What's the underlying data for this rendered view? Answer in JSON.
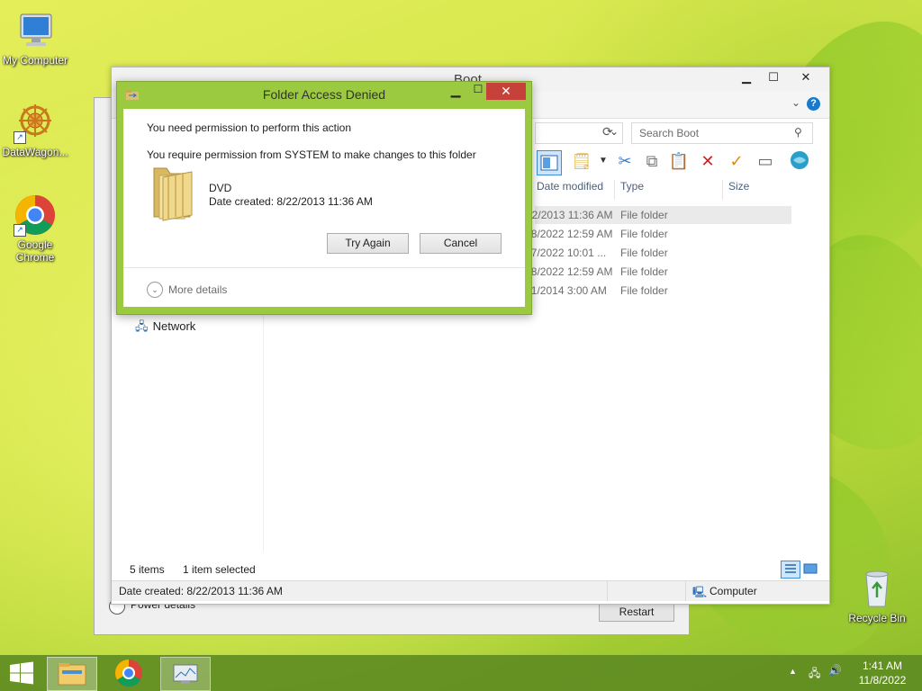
{
  "desktop": {
    "icons": [
      {
        "label": "My Computer",
        "icon": "computer-icon"
      },
      {
        "label": "DataWagon...",
        "icon": "datawagon-icon"
      },
      {
        "label": "Google Chrome",
        "icon": "chrome-icon"
      },
      {
        "label": "Recycle Bin",
        "icon": "recycle-bin-icon"
      }
    ]
  },
  "background_dialog": {
    "radio_label": "Power details",
    "button_label": "Restart"
  },
  "explorer": {
    "title": "Boot",
    "search_placeholder": "Search Boot",
    "columns": [
      "Date modified",
      "Type",
      "Size"
    ],
    "rows": [
      {
        "date": "8/22/2013 11:36 AM",
        "type": "File folder"
      },
      {
        "date": "11/8/2022 12:59 AM",
        "type": "File folder"
      },
      {
        "date": "11/7/2022 10:01 ...",
        "type": "File folder"
      },
      {
        "date": "11/8/2022 12:59 AM",
        "type": "File folder"
      },
      {
        "date": "4/11/2014 3:00 AM",
        "type": "File folder"
      }
    ],
    "nav_network": "Network",
    "status_items": "5 items",
    "status_selected": "1 item selected",
    "details_date": "Date created: 8/22/2013 11:36 AM",
    "details_location": "Computer"
  },
  "dialog": {
    "title": "Folder Access Denied",
    "message1": "You need permission to perform this action",
    "message2": "You require permission from SYSTEM to make changes to this folder",
    "folder_name": "DVD",
    "folder_date": "Date created: 8/22/2013 11:36 AM",
    "try_again_label": "Try Again",
    "cancel_label": "Cancel",
    "more_details_label": "More details",
    "accent_color": "#9bc93f"
  },
  "taskbar": {
    "time": "1:41 AM",
    "date": "11/8/2022"
  }
}
